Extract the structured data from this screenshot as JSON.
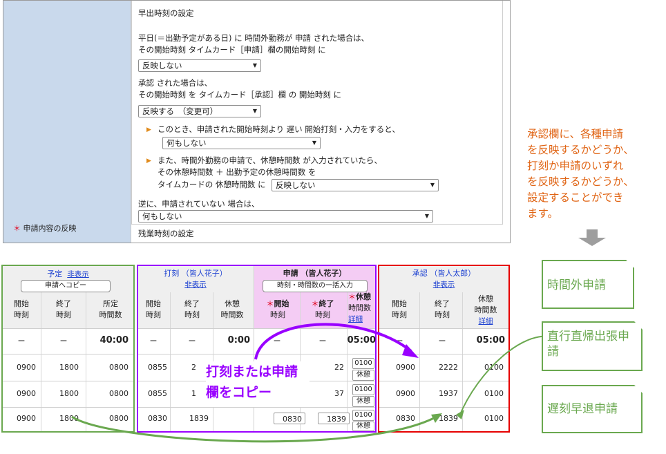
{
  "settings": {
    "section_title": "早出時刻の設定",
    "p1_line1": "平日(＝出勤予定がある日) に 時間外勤務が 申請 された場合は、",
    "p1_line2": "その開始時刻 タイムカード［申請］欄の開始時刻 に",
    "select1": "反映しない",
    "p2_line1": "承認 された場合は、",
    "p2_line2": "その開始時刻 を タイムカード［承認］欄 の 開始時刻 に",
    "select2": "反映する　（変更可）",
    "b1_line": "このとき、申請された開始時刻より 遅い 開始打刻・入力をすると、",
    "select3": "何もしない",
    "b2_line1": "また、時間外勤務の申請で、休憩時間数 が入力されていたら、",
    "b2_line2": "その休憩時間数 ＋ 出勤予定の休憩時間数 を",
    "b2_line3": "タイムカードの 休憩時間数 に",
    "select4": "反映しない",
    "p3_line": "逆に、申請されていない 場合は、",
    "select5": "何もしない",
    "left_label_star": "＊",
    "left_label": "申請内容の反映",
    "next_section": "残業時刻の設定"
  },
  "note": {
    "lines": [
      "承認欄に、各種申請",
      "を反映するかどうか、",
      "打刻か申請のいずれ",
      "を反映するかどうか、",
      "設定することができ",
      "ます。"
    ]
  },
  "tables": {
    "yotei": {
      "title": "予定",
      "hide": "非表示",
      "button": "申請へコピー",
      "cols": [
        [
          "開始",
          "時刻"
        ],
        [
          "終了",
          "時刻"
        ],
        [
          "所定",
          "時間数"
        ]
      ],
      "totals": [
        "ー",
        "ー",
        "40:00"
      ],
      "rows": [
        [
          "0900",
          "1800",
          "0800"
        ],
        [
          "0900",
          "1800",
          "0800"
        ],
        [
          "0900",
          "1800",
          "0800"
        ]
      ]
    },
    "dakoku": {
      "title": "打刻 （皆人花子）",
      "hide": "非表示",
      "cols": [
        [
          "開始",
          "時刻"
        ],
        [
          "終了",
          "時刻"
        ],
        [
          "休憩",
          "時間数"
        ]
      ],
      "totals": [
        "ー",
        "ー",
        "0:00"
      ],
      "rows": [
        [
          "0855",
          "2",
          ""
        ],
        [
          "0855",
          "1",
          ""
        ],
        [
          "0830",
          "1839",
          ""
        ]
      ]
    },
    "shinsei": {
      "title": "申請 （皆人花子）",
      "button": "時刻・時間数の一括入力",
      "cols": [
        [
          "開始",
          "時刻"
        ],
        [
          "終了",
          "時刻"
        ],
        [
          "休憩",
          "時間数"
        ]
      ],
      "star": "＊",
      "detail": "詳細",
      "totals": [
        "ー",
        "ー",
        "05:00"
      ],
      "rows": [
        [
          "",
          "22",
          "0100"
        ],
        [
          "",
          "37",
          "0100"
        ],
        [
          "0830",
          "1839",
          "0100"
        ]
      ],
      "break_label": "休憩"
    },
    "shonin": {
      "title": "承認 （皆人太郎）",
      "hide": "非表示",
      "cols": [
        [
          "開始",
          "時刻"
        ],
        [
          "終了",
          "時刻"
        ],
        [
          "休憩",
          "時間数"
        ]
      ],
      "detail": "詳細",
      "totals": [
        "ー",
        "ー",
        "05:00"
      ],
      "rows": [
        [
          "0900",
          "2222",
          "0100"
        ],
        [
          "0900",
          "1937",
          "0100"
        ],
        [
          "0830",
          "1839",
          "0100"
        ]
      ]
    }
  },
  "overlay": {
    "copy_line1": "打刻または申請",
    "copy_line2": "欄をコピー"
  },
  "callouts": [
    "時間外申請",
    "直行直帰出張申請",
    "遅刻早退申請"
  ],
  "colors": {
    "green": "#6aa84f",
    "purple": "#9900ff",
    "red": "#e60000",
    "note": "#e06414",
    "magenta_bg": "#f4ccf4",
    "left_col": "#c9d9ec"
  }
}
